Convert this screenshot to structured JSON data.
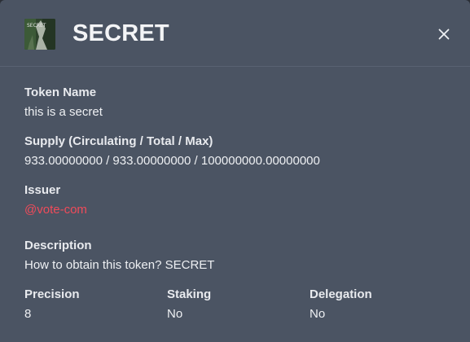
{
  "token": {
    "symbol": "SECRET",
    "icon_text": "SECRET",
    "icon": "token-logo-icon"
  },
  "close": {
    "icon": "close-icon"
  },
  "fields": {
    "token_name": {
      "label": "Token Name",
      "value": "this is a secret"
    },
    "supply": {
      "label": "Supply (Circulating / Total / Max)",
      "value": "933.00000000 / 933.00000000 / 100000000.00000000"
    },
    "issuer": {
      "label": "Issuer",
      "value": "@vote-com"
    },
    "description": {
      "label": "Description",
      "value": "How to obtain this token? SECRET"
    },
    "precision": {
      "label": "Precision",
      "value": "8"
    },
    "staking": {
      "label": "Staking",
      "value": "No"
    },
    "delegation": {
      "label": "Delegation",
      "value": "No"
    }
  },
  "colors": {
    "background": "#4b5463",
    "text": "#f3f4f6",
    "link": "#f04b5a"
  }
}
